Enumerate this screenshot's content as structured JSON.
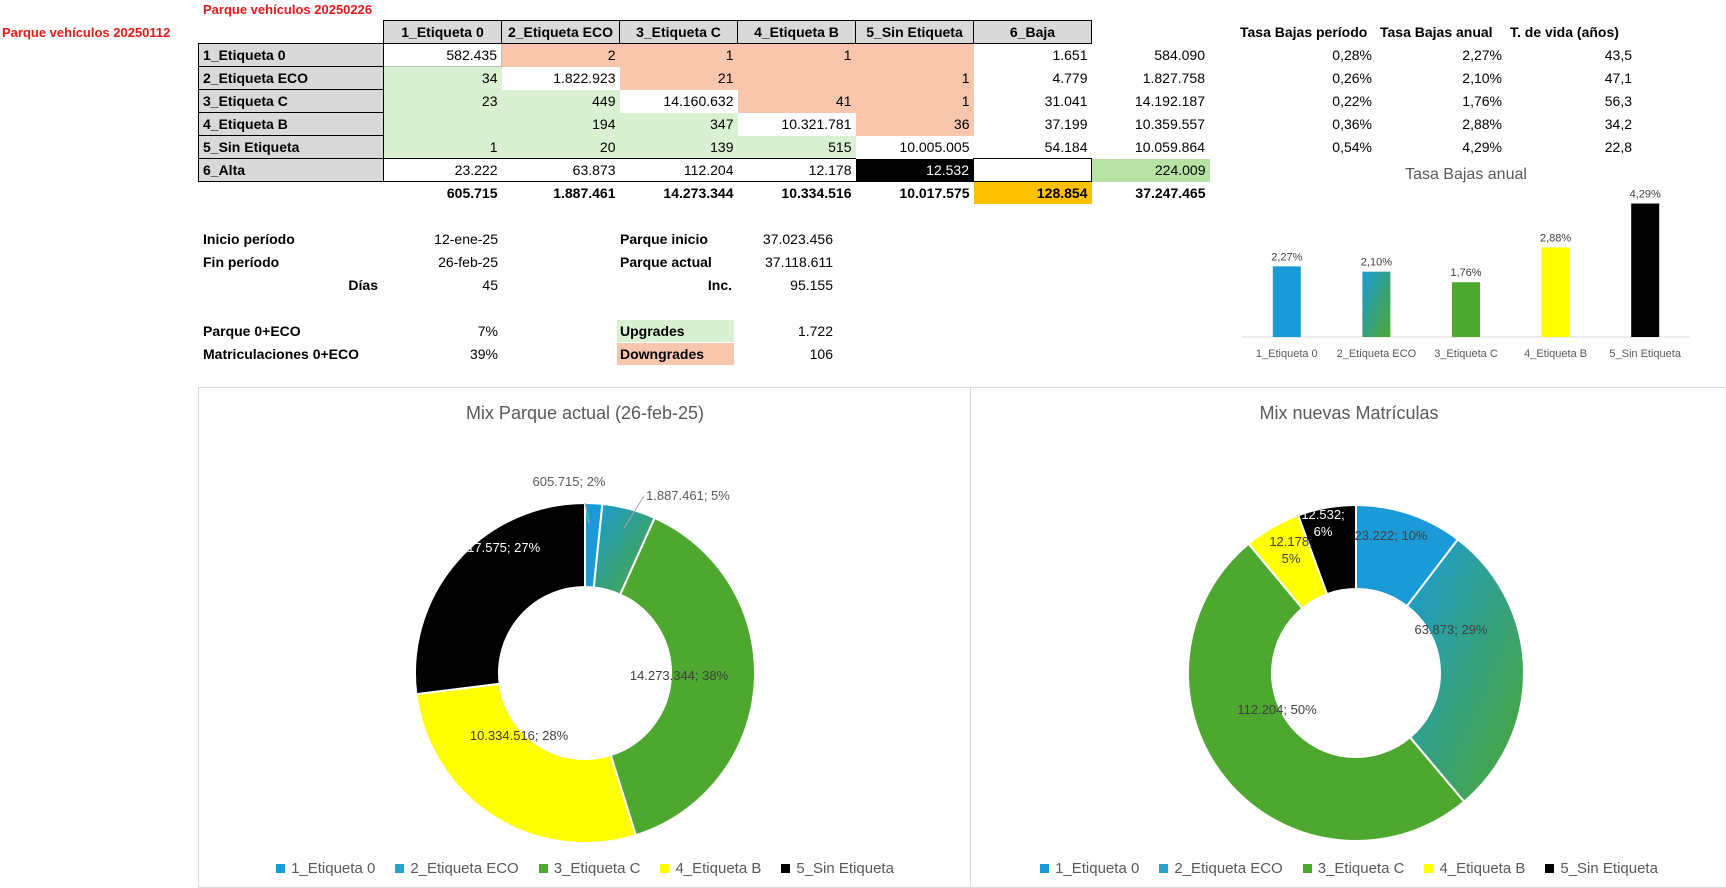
{
  "titles": {
    "current": "Parque vehículos 20250226",
    "previous": "Parque vehículos 20250112"
  },
  "matrix": {
    "headers": [
      "1_Etiqueta 0",
      "2_Etiqueta ECO",
      "3_Etiqueta C",
      "4_Etiqueta B",
      "5_Sin Etiqueta",
      "6_Baja"
    ],
    "rows": [
      {
        "label": "1_Etiqueta 0",
        "cells": [
          "582.435",
          "2",
          "1",
          "1",
          "",
          "1.651",
          "584.090"
        ]
      },
      {
        "label": "2_Etiqueta ECO",
        "cells": [
          "34",
          "1.822.923",
          "21",
          "",
          "1",
          "4.779",
          "1.827.758"
        ]
      },
      {
        "label": "3_Etiqueta C",
        "cells": [
          "23",
          "449",
          "14.160.632",
          "41",
          "1",
          "31.041",
          "14.192.187"
        ]
      },
      {
        "label": "4_Etiqueta B",
        "cells": [
          "",
          "194",
          "347",
          "10.321.781",
          "36",
          "37.199",
          "10.359.557"
        ]
      },
      {
        "label": "5_Sin Etiqueta",
        "cells": [
          "1",
          "20",
          "139",
          "515",
          "10.005.005",
          "54.184",
          "10.059.864"
        ]
      },
      {
        "label": "6_Alta",
        "cells": [
          "23.222",
          "63.873",
          "112.204",
          "12.178",
          "12.532",
          "",
          "224.009"
        ]
      }
    ],
    "totals": [
      "605.715",
      "1.887.461",
      "14.273.344",
      "10.334.516",
      "10.017.575",
      "128.854",
      "37.247.465"
    ]
  },
  "colors": {
    "green": "#d9f0d2",
    "salmon": "#f7c6ac",
    "orange": "#ffc000",
    "alta_green": "#b6e2a3",
    "black": "#000000"
  },
  "period": {
    "inicio_label": "Inicio período",
    "inicio": "12-ene-25",
    "fin_label": "Fin período",
    "fin": "26-feb-25",
    "dias_label": "Días",
    "dias": "45",
    "parque_inicio_label": "Parque inicio",
    "parque_inicio": "37.023.456",
    "parque_actual_label": "Parque actual",
    "parque_actual": "37.118.611",
    "inc_label": "Inc.",
    "inc": "95.155",
    "p0eco_label": "Parque 0+ECO",
    "p0eco": "7%",
    "m0eco_label": "Matriculaciones 0+ECO",
    "m0eco": "39%",
    "upgrades_label": "Upgrades",
    "upgrades": "1.722",
    "downgrades_label": "Downgrades",
    "downgrades": "106"
  },
  "stats": {
    "headers": [
      "Tasa Bajas período",
      "Tasa Bajas anual",
      "T. de vida (años)"
    ],
    "rows": [
      [
        "0,28%",
        "2,27%",
        "43,5"
      ],
      [
        "0,26%",
        "2,10%",
        "47,1"
      ],
      [
        "0,22%",
        "1,76%",
        "56,3"
      ],
      [
        "0,36%",
        "2,88%",
        "34,2"
      ],
      [
        "0,54%",
        "4,29%",
        "22,8"
      ]
    ]
  },
  "chart_data": [
    {
      "type": "bar",
      "title": "Tasa Bajas anual",
      "categories": [
        "1_Etiqueta 0",
        "2_Etiqueta ECO",
        "3_Etiqueta C",
        "4_Etiqueta B",
        "5_Sin Etiqueta"
      ],
      "values": [
        2.27,
        2.1,
        1.76,
        2.88,
        4.29
      ],
      "data_labels": [
        "2,27%",
        "2,10%",
        "1,76%",
        "2,88%",
        "4,29%"
      ],
      "colors": [
        "#1a9bd7",
        "#2aa3c9",
        "#4ea72e",
        "#ffff00",
        "#000000"
      ],
      "ylim": [
        0,
        4.5
      ],
      "grid": false
    },
    {
      "type": "pie",
      "title": "Mix Parque actual (26-feb-25)",
      "categories": [
        "1_Etiqueta 0",
        "2_Etiqueta ECO",
        "3_Etiqueta C",
        "4_Etiqueta B",
        "5_Sin Etiqueta"
      ],
      "values": [
        605715,
        1887461,
        14273344,
        10334516,
        10017575
      ],
      "data_labels": [
        "605.715; 2%",
        "1.887.461; 5%",
        "14.273.344; 38%",
        "10.334.516; 28%",
        "10.017.575; 27%"
      ],
      "colors": [
        "#1a9bd7",
        "#2aa3c9",
        "#4ea72e",
        "#ffff00",
        "#000000"
      ],
      "legend": "bottom"
    },
    {
      "type": "pie",
      "title": "Mix nuevas Matrículas",
      "categories": [
        "1_Etiqueta 0",
        "2_Etiqueta ECO",
        "3_Etiqueta C",
        "4_Etiqueta B",
        "5_Sin Etiqueta"
      ],
      "values": [
        23222,
        63873,
        112204,
        12178,
        12532
      ],
      "data_labels": [
        "23.222; 10%",
        "63.873; 29%",
        "112.204; 50%",
        "12.178; 5%",
        "12.532; 6%"
      ],
      "colors": [
        "#1a9bd7",
        "#2aa3c9",
        "#4ea72e",
        "#ffff00",
        "#000000"
      ],
      "legend": "bottom"
    }
  ]
}
